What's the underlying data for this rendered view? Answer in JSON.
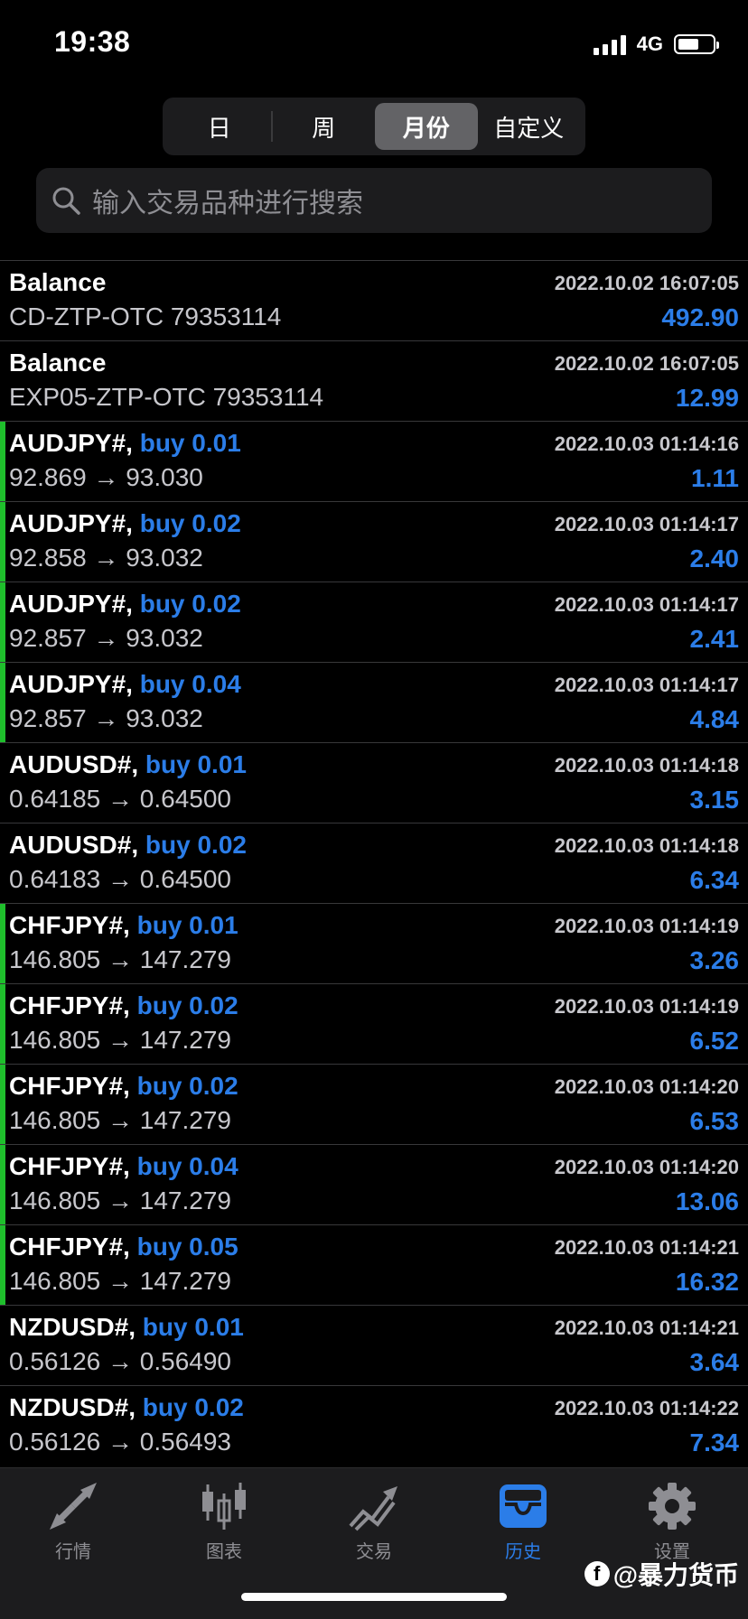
{
  "status": {
    "time": "19:38",
    "network": "4G"
  },
  "segments": [
    {
      "label": "日",
      "active": false
    },
    {
      "label": "周",
      "active": false
    },
    {
      "label": "月份",
      "active": true
    },
    {
      "label": "自定义",
      "active": false
    }
  ],
  "search": {
    "placeholder": "输入交易品种进行搜索"
  },
  "rows": [
    {
      "symbol": "Balance",
      "side": "",
      "detail": "CD-ZTP-OTC 79353114",
      "time": "2022.10.02 16:07:05",
      "profit": "492.90",
      "marked": false
    },
    {
      "symbol": "Balance",
      "side": "",
      "detail": "EXP05-ZTP-OTC 79353114",
      "time": "2022.10.02 16:07:05",
      "profit": "12.99",
      "marked": false
    },
    {
      "symbol": "AUDJPY#,",
      "side": "buy 0.01",
      "detail": "92.869 → 93.030",
      "time": "2022.10.03 01:14:16",
      "profit": "1.11",
      "marked": true
    },
    {
      "symbol": "AUDJPY#,",
      "side": "buy 0.02",
      "detail": "92.858 → 93.032",
      "time": "2022.10.03 01:14:17",
      "profit": "2.40",
      "marked": true
    },
    {
      "symbol": "AUDJPY#,",
      "side": "buy 0.02",
      "detail": "92.857 → 93.032",
      "time": "2022.10.03 01:14:17",
      "profit": "2.41",
      "marked": true
    },
    {
      "symbol": "AUDJPY#,",
      "side": "buy 0.04",
      "detail": "92.857 → 93.032",
      "time": "2022.10.03 01:14:17",
      "profit": "4.84",
      "marked": true
    },
    {
      "symbol": "AUDUSD#,",
      "side": "buy 0.01",
      "detail": "0.64185 → 0.64500",
      "time": "2022.10.03 01:14:18",
      "profit": "3.15",
      "marked": false
    },
    {
      "symbol": "AUDUSD#,",
      "side": "buy 0.02",
      "detail": "0.64183 → 0.64500",
      "time": "2022.10.03 01:14:18",
      "profit": "6.34",
      "marked": false
    },
    {
      "symbol": "CHFJPY#,",
      "side": "buy 0.01",
      "detail": "146.805 → 147.279",
      "time": "2022.10.03 01:14:19",
      "profit": "3.26",
      "marked": true
    },
    {
      "symbol": "CHFJPY#,",
      "side": "buy 0.02",
      "detail": "146.805 → 147.279",
      "time": "2022.10.03 01:14:19",
      "profit": "6.52",
      "marked": true
    },
    {
      "symbol": "CHFJPY#,",
      "side": "buy 0.02",
      "detail": "146.805 → 147.279",
      "time": "2022.10.03 01:14:20",
      "profit": "6.53",
      "marked": true
    },
    {
      "symbol": "CHFJPY#,",
      "side": "buy 0.04",
      "detail": "146.805 → 147.279",
      "time": "2022.10.03 01:14:20",
      "profit": "13.06",
      "marked": true
    },
    {
      "symbol": "CHFJPY#,",
      "side": "buy 0.05",
      "detail": "146.805 → 147.279",
      "time": "2022.10.03 01:14:21",
      "profit": "16.32",
      "marked": true
    },
    {
      "symbol": "NZDUSD#,",
      "side": "buy 0.01",
      "detail": "0.56126 → 0.56490",
      "time": "2022.10.03 01:14:21",
      "profit": "3.64",
      "marked": false
    },
    {
      "symbol": "NZDUSD#,",
      "side": "buy 0.02",
      "detail": "0.56126 → 0.56493",
      "time": "2022.10.03 01:14:22",
      "profit": "7.34",
      "marked": false
    }
  ],
  "tabs": [
    {
      "label": "行情",
      "icon": "quotes-arrows-icon",
      "active": false
    },
    {
      "label": "图表",
      "icon": "candlestick-chart-icon",
      "active": false
    },
    {
      "label": "交易",
      "icon": "trade-trend-icon",
      "active": false
    },
    {
      "label": "历史",
      "icon": "history-inbox-icon",
      "active": true
    },
    {
      "label": "设置",
      "icon": "gear-icon",
      "active": false
    }
  ],
  "watermark": {
    "text": "@暴力货币",
    "logo_letter": "f"
  },
  "colors": {
    "accent": "#2b7de8",
    "marker": "#1fbf2c",
    "background": "#000000"
  }
}
